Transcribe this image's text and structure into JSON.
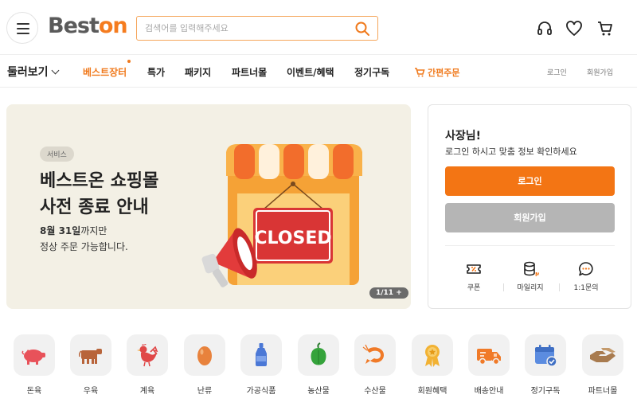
{
  "header": {
    "logo_main": "Best",
    "logo_accent": "on",
    "search_placeholder": "검색어를 입력해주세요"
  },
  "nav": {
    "browse": "둘러보기",
    "items": [
      "베스트장터",
      "특가",
      "패키지",
      "파트너몰",
      "이벤트/혜택",
      "정기구독"
    ],
    "quick_order": "간편주문",
    "login": "로그인",
    "signup": "회원가입"
  },
  "banner": {
    "badge": "서비스",
    "title_line1": "베스트온 쇼핑몰",
    "title_line2": "사전 종료 안내",
    "sub_date": "8월 31일",
    "sub_line1_rest": "까지만",
    "sub_line2": "정상 주문 가능합니다.",
    "sign_text": "CLOSED",
    "counter": "1/11 +"
  },
  "login_panel": {
    "greeting": "사장님!",
    "subtext": "로그인 하시고 맞춤 정보 확인하세요",
    "login_button": "로그인",
    "signup_button": "회원가입",
    "shortcuts": [
      {
        "label": "쿠폰",
        "icon": "coupon-icon"
      },
      {
        "label": "마일리지",
        "icon": "mileage-icon"
      },
      {
        "label": "1:1문의",
        "icon": "chat-icon"
      }
    ]
  },
  "categories": [
    {
      "label": "돈육",
      "icon": "pig-icon"
    },
    {
      "label": "우육",
      "icon": "cow-icon"
    },
    {
      "label": "계육",
      "icon": "chicken-icon"
    },
    {
      "label": "난류",
      "icon": "egg-icon"
    },
    {
      "label": "가공식품",
      "icon": "sauce-bottle-icon"
    },
    {
      "label": "농산물",
      "icon": "pepper-icon"
    },
    {
      "label": "수산물",
      "icon": "shrimp-icon"
    },
    {
      "label": "회원혜택",
      "icon": "medal-icon"
    },
    {
      "label": "배송안내",
      "icon": "truck-icon"
    },
    {
      "label": "정기구독",
      "icon": "calendar-icon"
    },
    {
      "label": "파트너몰",
      "icon": "handshake-icon"
    }
  ],
  "colors": {
    "accent": "#f37514",
    "disabled_button": "#b5b5b5",
    "banner_bg": "#f3f0e5",
    "tile_bg": "#f1f1f1"
  }
}
